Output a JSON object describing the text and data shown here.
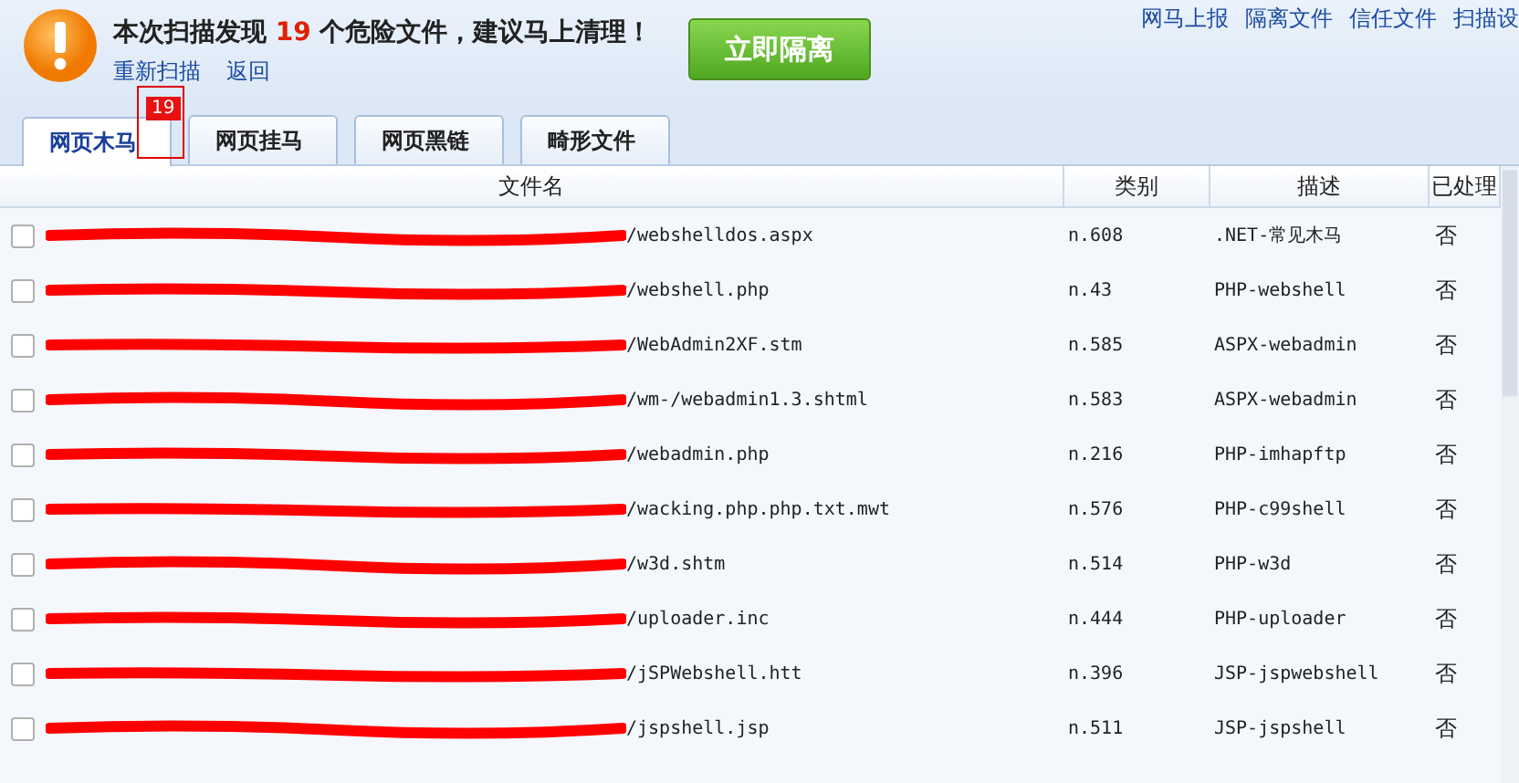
{
  "header": {
    "message": "本次扫描发现 **19** 个危险文件，建议马上清理！",
    "links": [
      "重新扫描",
      "返回"
    ],
    "action_button": "立即隔离",
    "top_links": [
      "网马上报",
      "隔离文件",
      "信任文件",
      "扫描设"
    ]
  },
  "tabs": [
    {
      "label": "网页木马",
      "selected": true,
      "badge": "19"
    },
    {
      "label": "网页挂马",
      "selected": false
    },
    {
      "label": "网页黑链",
      "selected": false
    },
    {
      "label": "畸形文件",
      "selected": false
    }
  ],
  "table": {
    "columns": [
      "文件名",
      "类别",
      "描述",
      "已处理"
    ],
    "rows": [
      {
        "checked": false,
        "file": "/webshelldos.aspx",
        "category": "n.608",
        "description": ".NET-常见木马",
        "processed": "否"
      },
      {
        "checked": false,
        "file": "/webshell.php",
        "category": "n.43",
        "description": "PHP-webshell",
        "processed": "否"
      },
      {
        "checked": false,
        "file": "/WebAdmin2XF.stm",
        "category": "n.585",
        "description": "ASPX-webadmin",
        "processed": "否"
      },
      {
        "checked": false,
        "file": "/wm-/webadmin1.3.shtml",
        "category": "n.583",
        "description": "ASPX-webadmin",
        "processed": "否"
      },
      {
        "checked": false,
        "file": "/webadmin.php",
        "category": "n.216",
        "description": "PHP-imhapftp",
        "processed": "否"
      },
      {
        "checked": false,
        "file": "/wacking.php.php.txt.mwt",
        "category": "n.576",
        "description": "PHP-c99shell",
        "processed": "否"
      },
      {
        "checked": false,
        "file": "/w3d.shtm",
        "category": "n.514",
        "description": "PHP-w3d",
        "processed": "否"
      },
      {
        "checked": false,
        "file": "/uploader.inc",
        "category": "n.444",
        "description": "PHP-uploader",
        "processed": "否"
      },
      {
        "checked": false,
        "file": "/jSPWebshell.htt",
        "category": "n.396",
        "description": "JSP-jspwebshell",
        "processed": "否"
      },
      {
        "checked": false,
        "file": "/jspshell.jsp",
        "category": "n.511",
        "description": "JSP-jspshell",
        "processed": "否"
      }
    ]
  }
}
